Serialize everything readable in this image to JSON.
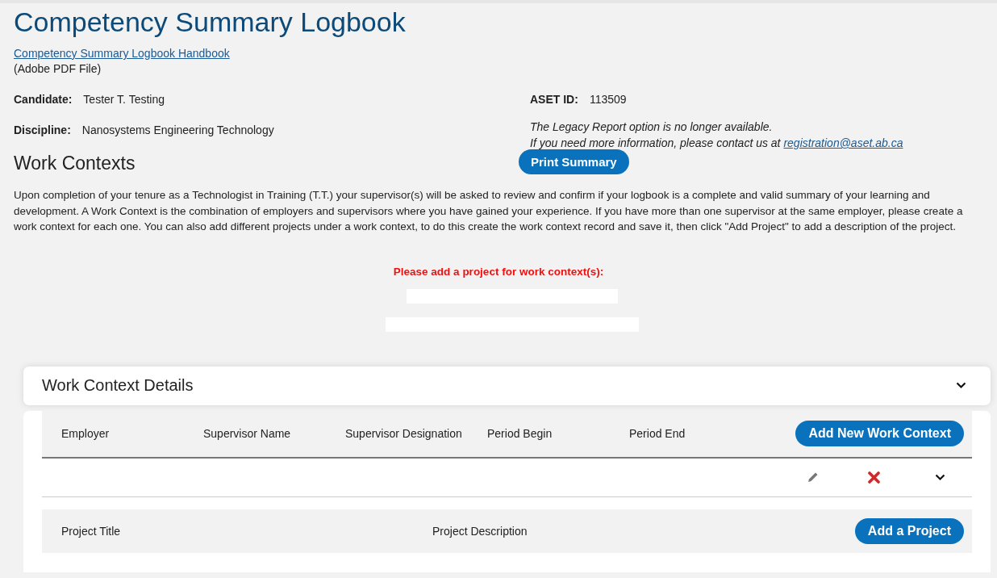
{
  "title": "Competency Summary Logbook",
  "handbook_link": "Competency Summary Logbook Handbook",
  "handbook_note": "(Adobe PDF File)",
  "candidate": {
    "label": "Candidate:",
    "value": "Tester T. Testing"
  },
  "discipline": {
    "label": "Discipline:",
    "value": "Nanosystems Engineering Technology"
  },
  "aset_id": {
    "label": "ASET ID:",
    "value": "113509"
  },
  "legacy_notice": {
    "line_1": "The Legacy Report option is no longer available.",
    "line_2": "If you need more information, please contact us at",
    "email": "registration@aset.ab.ca"
  },
  "section_title": "Work Contexts",
  "print_button": "Print Summary",
  "intro": "Upon completion of your tenure as a Technologist in Training (T.T.) your supervisor(s) will be asked to review and confirm if your logbook is a complete and valid summary of your learning and development. A Work Context is the combination of employers and supervisors where you have gained your experience. If you have more than one supervisor at the same employer, please create a work context for each one. You can also add different projects under a work context, to do this create the work context record and save it, then click \"Add Project\" to add a description of the project.",
  "warning": "Please add a project for work context(s):",
  "details": {
    "title": "Work Context Details",
    "columns": [
      "Employer",
      "Supervisor Name",
      "Supervisor Designation",
      "Period Begin",
      "Period End"
    ],
    "add_button": "Add New Work Context",
    "project_columns": [
      "Project Title",
      "Project Description"
    ],
    "add_project_button": "Add a Project"
  }
}
